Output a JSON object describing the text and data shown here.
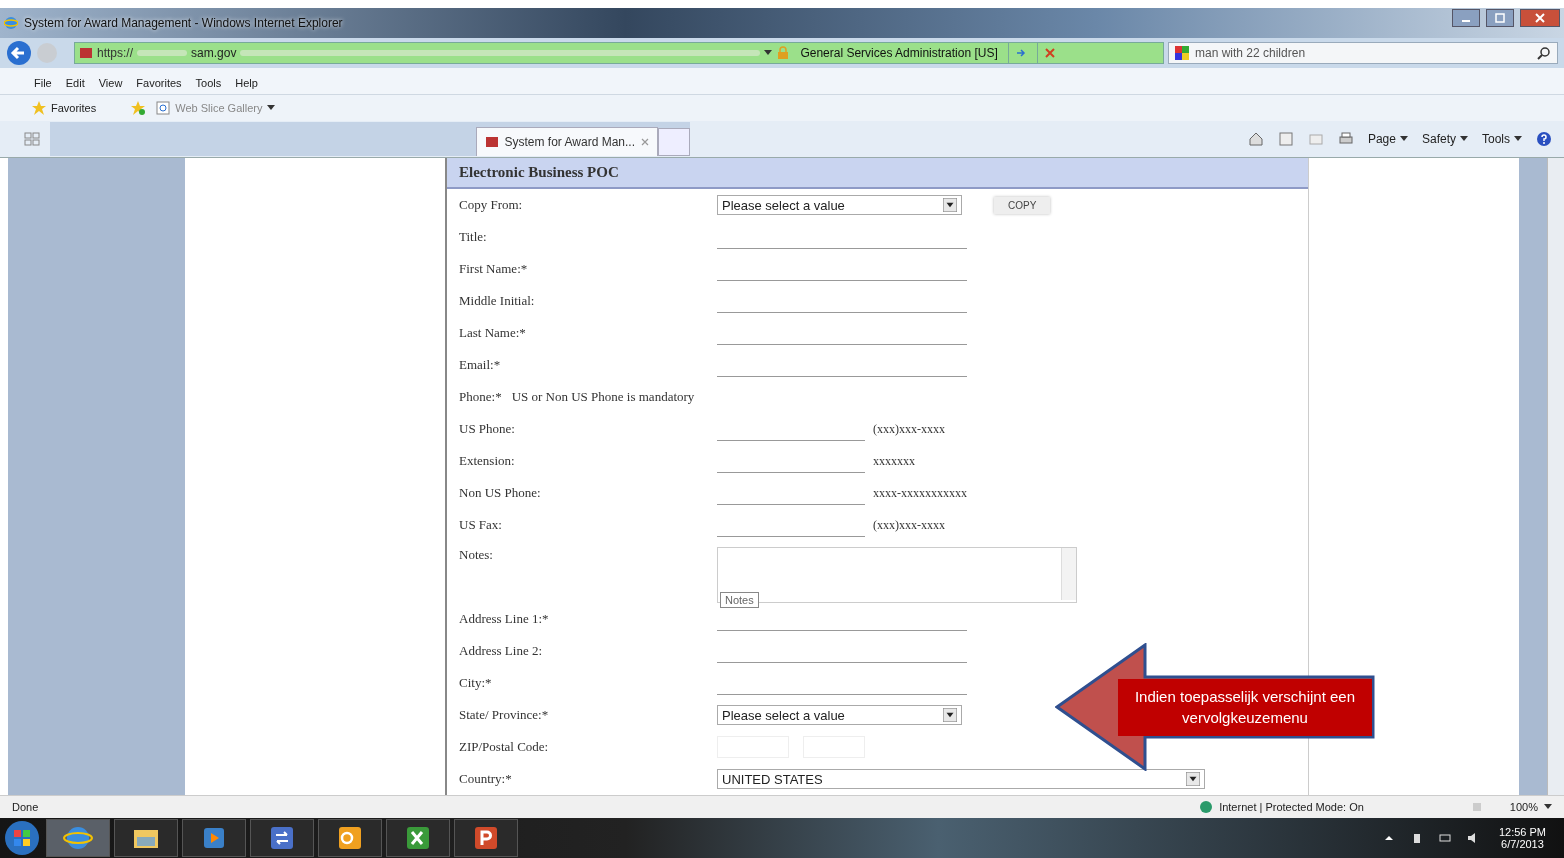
{
  "window": {
    "title": "System for Award Management - Windows Internet Explorer"
  },
  "address_bar": {
    "scheme": "https://",
    "host": "sam.gov",
    "security_label": "General Services Administration [US]"
  },
  "search": {
    "value": "man with 22 children"
  },
  "menu": [
    "File",
    "Edit",
    "View",
    "Favorites",
    "Tools",
    "Help"
  ],
  "favorites_bar": {
    "favorites": "Favorites",
    "gallery": "Web Slice Gallery"
  },
  "tabs": [
    {
      "label": "System for Award Man...",
      "selected": true
    }
  ],
  "command_bar": [
    "Page",
    "Safety",
    "Tools"
  ],
  "form": {
    "title": "Electronic Business POC",
    "fields": [
      {
        "kind": "select",
        "label": "Copy From:",
        "value": "Please select a value",
        "button": "COPY"
      },
      {
        "kind": "input",
        "label": "Title:"
      },
      {
        "kind": "input",
        "label": "First Name:",
        "marker": "*"
      },
      {
        "kind": "input",
        "label": "Middle Initial:"
      },
      {
        "kind": "input",
        "label": "Last Name:",
        "marker": "*"
      },
      {
        "kind": "input",
        "label": "Email:",
        "marker": "*"
      },
      {
        "kind": "note",
        "label": "Phone:",
        "marker": "*",
        "note": "US or Non US Phone is mandatory"
      },
      {
        "kind": "short",
        "label": "US Phone:",
        "hint": "(xxx)xxx-xxxx"
      },
      {
        "kind": "short",
        "label": "Extension:",
        "hint": "xxxxxxx"
      },
      {
        "kind": "short",
        "label": "Non US Phone:",
        "hint": "xxxx-xxxxxxxxxxx"
      },
      {
        "kind": "short",
        "label": "US Fax:",
        "hint": "(xxx)xxx-xxxx"
      },
      {
        "kind": "textarea",
        "label": "Notes:",
        "tooltip": "Notes"
      },
      {
        "kind": "input",
        "label": "Address Line 1:",
        "marker": "*"
      },
      {
        "kind": "input",
        "label": "Address Line 2:"
      },
      {
        "kind": "input",
        "label": "City:",
        "marker": "*"
      },
      {
        "kind": "select",
        "label": "State/ Province:",
        "marker": "*",
        "value": "Please select a value"
      },
      {
        "kind": "zip",
        "label": "ZIP/Postal Code:"
      },
      {
        "kind": "wide-select",
        "label": "Country:",
        "marker": "*",
        "value": "UNITED STATES"
      }
    ]
  },
  "callout": {
    "text": "Indien toepasselijk verschijnt een vervolgkeuzemenu"
  },
  "status_bar": {
    "status": "Done",
    "zone": "Internet | Protected Mode: On",
    "zoom": "100%"
  },
  "taskbar": {
    "time": "12:56 PM",
    "date": "6/7/2013"
  }
}
